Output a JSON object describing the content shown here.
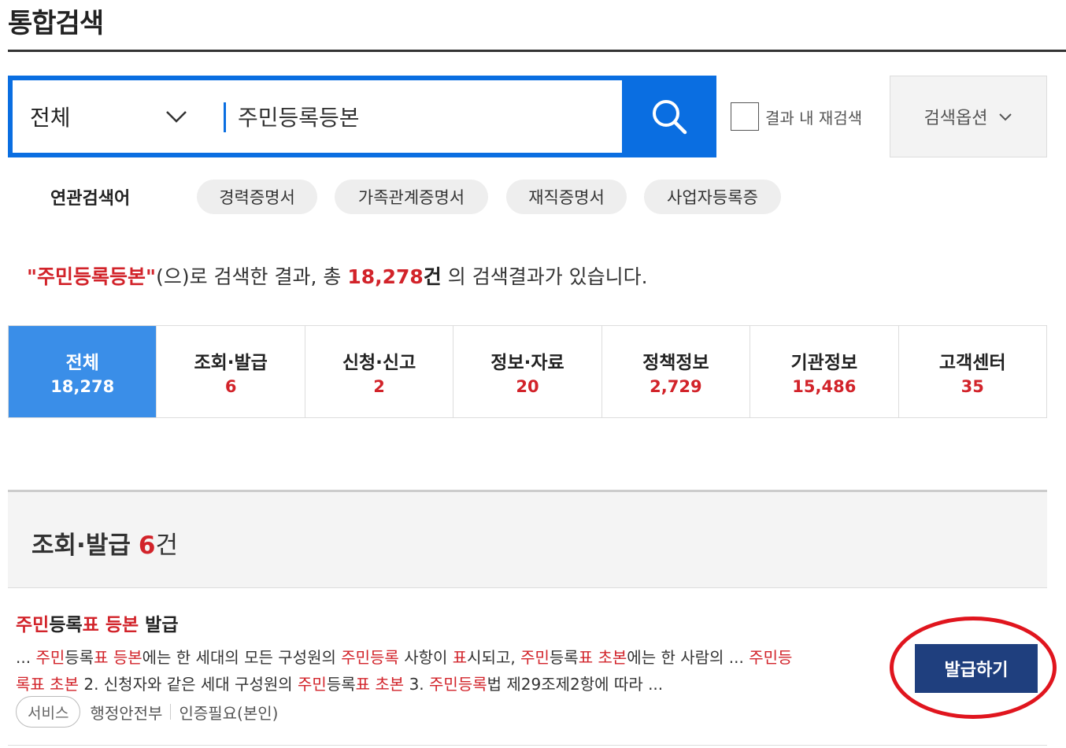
{
  "page": {
    "title": "통합검색"
  },
  "search": {
    "scope": "전체",
    "query": "주민등록등본",
    "rescan_label": "결과 내 재검색",
    "options_label": "검색옵션"
  },
  "related": {
    "label": "연관검색어",
    "keywords": [
      "경력증명서",
      "가족관계증명서",
      "재직증명서",
      "사업자등록증"
    ]
  },
  "summary": {
    "query_quoted": "\"주민등록등본\"",
    "text1": "(으)로 검색한 결과, 총 ",
    "total": "18,278",
    "unit": "건",
    "text2": " 의 검색결과가 있습니다."
  },
  "tabs": [
    {
      "label": "전체",
      "count": "18,278",
      "active": true
    },
    {
      "label": "조회·발급",
      "count": "6"
    },
    {
      "label": "신청·신고",
      "count": "2"
    },
    {
      "label": "정보·자료",
      "count": "20"
    },
    {
      "label": "정책정보",
      "count": "2,729"
    },
    {
      "label": "기관정보",
      "count": "15,486"
    },
    {
      "label": "고객센터",
      "count": "35"
    }
  ],
  "section": {
    "title": "조회·발급",
    "count": "6",
    "unit": "건"
  },
  "result": {
    "title": {
      "p1": "주민",
      "p2": "등록",
      "p3": "표",
      "p4": " ",
      "p5": "등본",
      "p6": " 발급"
    },
    "desc": {
      "a1": "... ",
      "a2": "주민",
      "a3": "등록",
      "a4": "표",
      "a5": " ",
      "a6": "등본",
      "a7": "에는 한 세대의 모든 구성원의 ",
      "a8": "주민등록",
      "a9": " 사항이 ",
      "a10": "표",
      "a11": "시되고, ",
      "a12": "주민",
      "a13": "등록",
      "a14": "표",
      "a15": " ",
      "a16": "초본",
      "a17": "에는 한 사람의 ... ",
      "a18": "주민",
      "a19": "등",
      "b1": "록",
      "b2": "표",
      "b3": " ",
      "b4": "초본",
      "b5": " 2. 신청자와 같은 세대 구성원의 ",
      "b6": "주민",
      "b7": "등록",
      "b8": "표",
      "b9": " ",
      "b10": "초본",
      "b11": " 3. ",
      "b12": "주민등록",
      "b13": "법 제29조제2항에 따라 ..."
    },
    "badge": "서비스",
    "agency": "행정안전부",
    "auth": "인증필요(본인)",
    "action_label": "발급하기"
  },
  "colors": {
    "primary_blue": "#0a6ee1",
    "active_tab": "#3a8ee8",
    "highlight_red": "#d2232a",
    "action_navy": "#1f3f7e",
    "annotation_red": "#e0151e"
  }
}
